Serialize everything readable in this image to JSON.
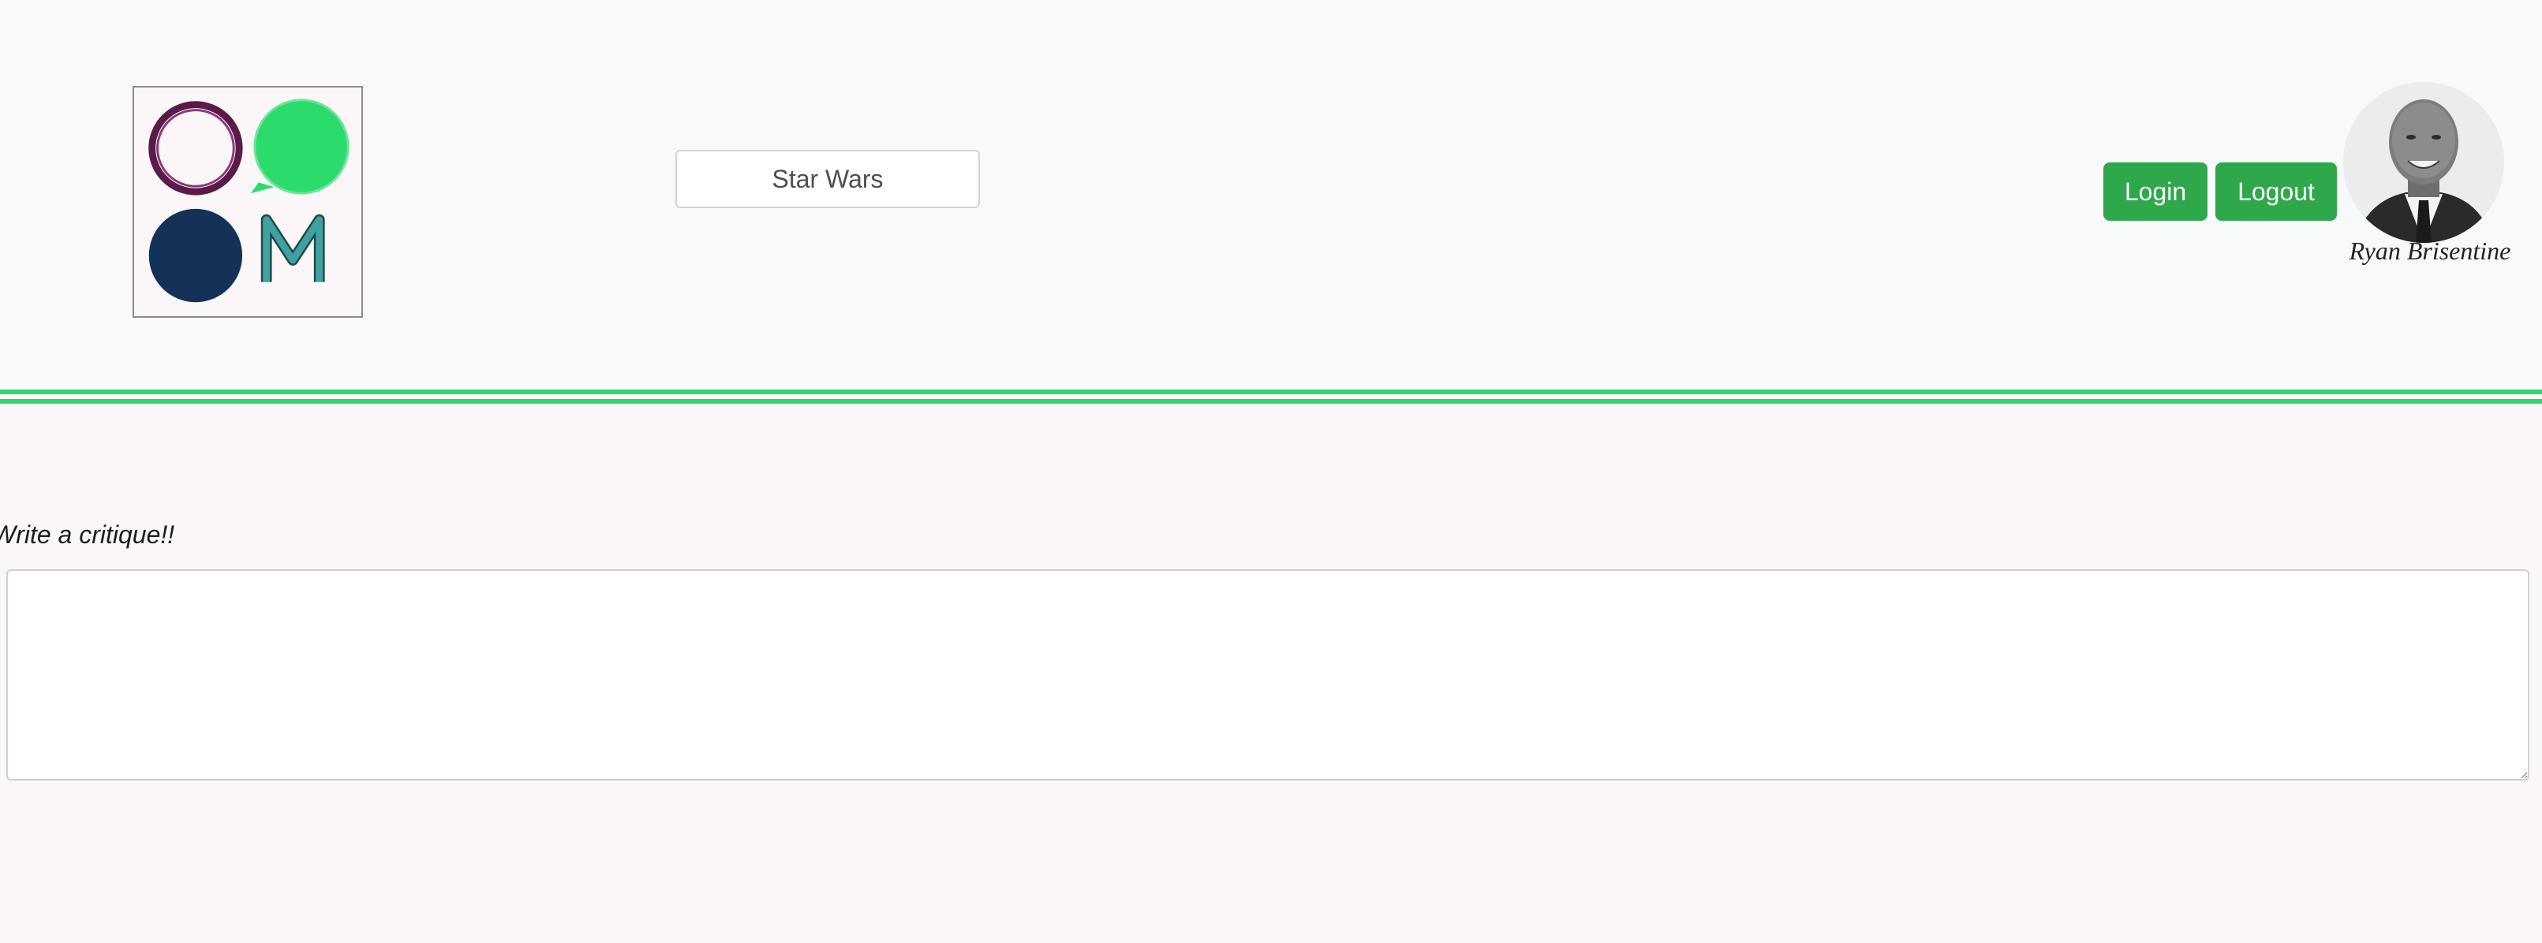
{
  "header": {
    "category_button": "Star Wars",
    "login_label": "Login",
    "logout_label": "Logout",
    "user_name": "Ryan Brisentine"
  },
  "critique": {
    "prompt": "Write a critique!!",
    "value": "",
    "placeholder": ""
  },
  "colors": {
    "accent_green": "#2fd76a",
    "button_green": "#2ea84a",
    "logo_purple": "#5a1a4a",
    "logo_navy": "#143257",
    "logo_teal": "#3a8c8c"
  }
}
